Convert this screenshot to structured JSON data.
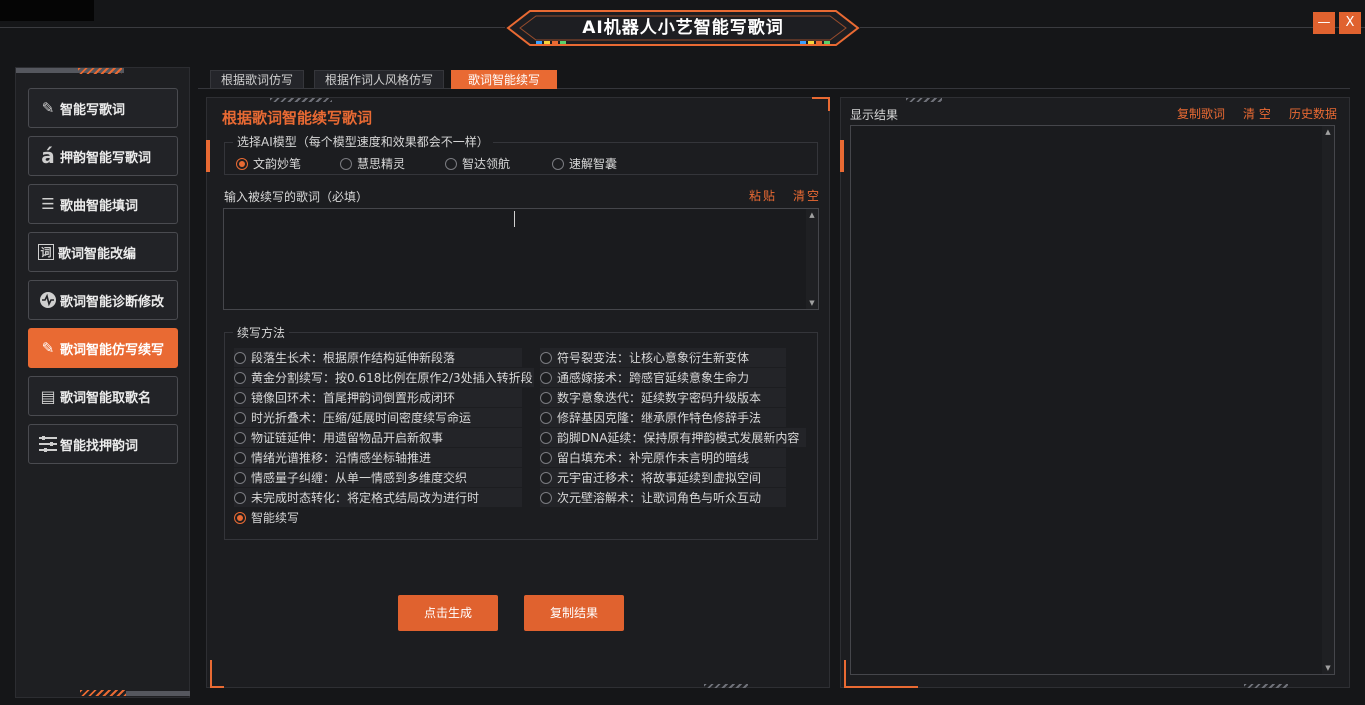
{
  "app": {
    "title": "AI机器人小艺智能写歌词"
  },
  "window": {
    "minimize_label": "—",
    "close_label": "X"
  },
  "sidebar": {
    "items": [
      {
        "label": "智能写歌词",
        "icon": "pen-icon"
      },
      {
        "label": "押韵智能写歌词",
        "icon": "a-accent-icon"
      },
      {
        "label": "歌曲智能填词",
        "icon": "list-icon"
      },
      {
        "label": "歌词智能改编",
        "icon": "ci-icon"
      },
      {
        "label": "歌词智能诊断修改",
        "icon": "pulse-icon"
      },
      {
        "label": "歌词智能仿写续写",
        "icon": "pen-icon",
        "active": true
      },
      {
        "label": "歌词智能取歌名",
        "icon": "doc-icon"
      },
      {
        "label": "智能找押韵词",
        "icon": "sliders-icon"
      }
    ]
  },
  "tabs": [
    {
      "label": "根据歌词仿写"
    },
    {
      "label": "根据作词人风格仿写"
    },
    {
      "label": "歌词智能续写",
      "active": true
    }
  ],
  "main": {
    "title": "根据歌词智能续写歌词",
    "model_group": {
      "legend": "选择AI模型（每个模型速度和效果都会不一样）",
      "options": [
        "文韵妙笔",
        "慧思精灵",
        "智达领航",
        "速解智囊"
      ],
      "selected": "文韵妙笔"
    },
    "input": {
      "label": "输入被续写的歌词（必填）",
      "paste": "粘贴",
      "clear": "清空",
      "value": ""
    },
    "method_group": {
      "legend": "续写方法",
      "left": [
        "段落生长术：根据原作结构延伸新段落",
        "黄金分割续写：按0.618比例在原作2/3处插入转折段",
        "镜像回环术：首尾押韵词倒置形成闭环",
        "时光折叠术：压缩/延展时间密度续写命运",
        "物证链延伸：用遗留物品开启新叙事",
        "情绪光谱推移：沿情感坐标轴推进",
        "情感量子纠缠：从单一情感到多维度交织",
        "未完成时态转化：将定格式结局改为进行时"
      ],
      "right": [
        "符号裂变法：让核心意象衍生新变体",
        "通感嫁接术：跨感官延续意象生命力",
        "数字意象迭代：延续数字密码升级版本",
        "修辞基因克隆：继承原作特色修辞手法",
        "韵脚DNA延续：保持原有押韵模式发展新内容",
        "留白填充术：补完原作未言明的暗线",
        "元宇宙迁移术：将故事延续到虚拟空间",
        "次元壁溶解术：让歌词角色与听众互动"
      ],
      "extra": "智能续写",
      "selected": "智能续写"
    },
    "generate_button": "点击生成",
    "copy_result_button": "复制结果"
  },
  "result": {
    "label": "显示结果",
    "copy": "复制歌词",
    "clear": "清 空",
    "history": "历史数据",
    "value": ""
  },
  "colors": {
    "accent": "#e96a33",
    "bg": "#151618",
    "panel": "#1c1d20"
  }
}
